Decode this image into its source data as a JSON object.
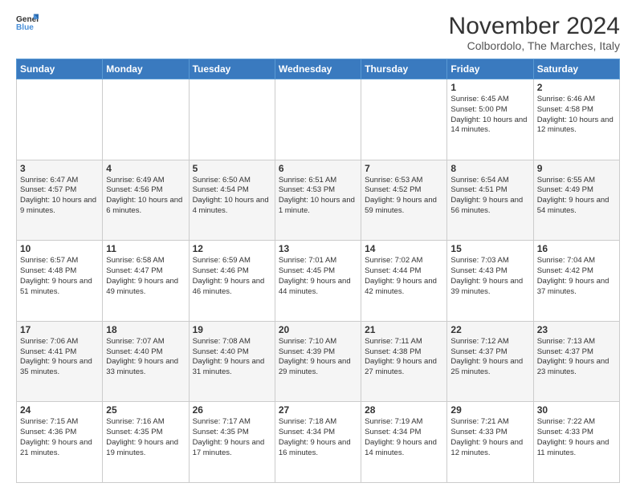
{
  "logo": {
    "line1": "General",
    "line2": "Blue"
  },
  "title": "November 2024",
  "subtitle": "Colbordolo, The Marches, Italy",
  "days_header": [
    "Sunday",
    "Monday",
    "Tuesday",
    "Wednesday",
    "Thursday",
    "Friday",
    "Saturday"
  ],
  "weeks": [
    [
      {
        "day": "",
        "info": ""
      },
      {
        "day": "",
        "info": ""
      },
      {
        "day": "",
        "info": ""
      },
      {
        "day": "",
        "info": ""
      },
      {
        "day": "",
        "info": ""
      },
      {
        "day": "1",
        "info": "Sunrise: 6:45 AM\nSunset: 5:00 PM\nDaylight: 10 hours and 14 minutes."
      },
      {
        "day": "2",
        "info": "Sunrise: 6:46 AM\nSunset: 4:58 PM\nDaylight: 10 hours and 12 minutes."
      }
    ],
    [
      {
        "day": "3",
        "info": "Sunrise: 6:47 AM\nSunset: 4:57 PM\nDaylight: 10 hours and 9 minutes."
      },
      {
        "day": "4",
        "info": "Sunrise: 6:49 AM\nSunset: 4:56 PM\nDaylight: 10 hours and 6 minutes."
      },
      {
        "day": "5",
        "info": "Sunrise: 6:50 AM\nSunset: 4:54 PM\nDaylight: 10 hours and 4 minutes."
      },
      {
        "day": "6",
        "info": "Sunrise: 6:51 AM\nSunset: 4:53 PM\nDaylight: 10 hours and 1 minute."
      },
      {
        "day": "7",
        "info": "Sunrise: 6:53 AM\nSunset: 4:52 PM\nDaylight: 9 hours and 59 minutes."
      },
      {
        "day": "8",
        "info": "Sunrise: 6:54 AM\nSunset: 4:51 PM\nDaylight: 9 hours and 56 minutes."
      },
      {
        "day": "9",
        "info": "Sunrise: 6:55 AM\nSunset: 4:49 PM\nDaylight: 9 hours and 54 minutes."
      }
    ],
    [
      {
        "day": "10",
        "info": "Sunrise: 6:57 AM\nSunset: 4:48 PM\nDaylight: 9 hours and 51 minutes."
      },
      {
        "day": "11",
        "info": "Sunrise: 6:58 AM\nSunset: 4:47 PM\nDaylight: 9 hours and 49 minutes."
      },
      {
        "day": "12",
        "info": "Sunrise: 6:59 AM\nSunset: 4:46 PM\nDaylight: 9 hours and 46 minutes."
      },
      {
        "day": "13",
        "info": "Sunrise: 7:01 AM\nSunset: 4:45 PM\nDaylight: 9 hours and 44 minutes."
      },
      {
        "day": "14",
        "info": "Sunrise: 7:02 AM\nSunset: 4:44 PM\nDaylight: 9 hours and 42 minutes."
      },
      {
        "day": "15",
        "info": "Sunrise: 7:03 AM\nSunset: 4:43 PM\nDaylight: 9 hours and 39 minutes."
      },
      {
        "day": "16",
        "info": "Sunrise: 7:04 AM\nSunset: 4:42 PM\nDaylight: 9 hours and 37 minutes."
      }
    ],
    [
      {
        "day": "17",
        "info": "Sunrise: 7:06 AM\nSunset: 4:41 PM\nDaylight: 9 hours and 35 minutes."
      },
      {
        "day": "18",
        "info": "Sunrise: 7:07 AM\nSunset: 4:40 PM\nDaylight: 9 hours and 33 minutes."
      },
      {
        "day": "19",
        "info": "Sunrise: 7:08 AM\nSunset: 4:40 PM\nDaylight: 9 hours and 31 minutes."
      },
      {
        "day": "20",
        "info": "Sunrise: 7:10 AM\nSunset: 4:39 PM\nDaylight: 9 hours and 29 minutes."
      },
      {
        "day": "21",
        "info": "Sunrise: 7:11 AM\nSunset: 4:38 PM\nDaylight: 9 hours and 27 minutes."
      },
      {
        "day": "22",
        "info": "Sunrise: 7:12 AM\nSunset: 4:37 PM\nDaylight: 9 hours and 25 minutes."
      },
      {
        "day": "23",
        "info": "Sunrise: 7:13 AM\nSunset: 4:37 PM\nDaylight: 9 hours and 23 minutes."
      }
    ],
    [
      {
        "day": "24",
        "info": "Sunrise: 7:15 AM\nSunset: 4:36 PM\nDaylight: 9 hours and 21 minutes."
      },
      {
        "day": "25",
        "info": "Sunrise: 7:16 AM\nSunset: 4:35 PM\nDaylight: 9 hours and 19 minutes."
      },
      {
        "day": "26",
        "info": "Sunrise: 7:17 AM\nSunset: 4:35 PM\nDaylight: 9 hours and 17 minutes."
      },
      {
        "day": "27",
        "info": "Sunrise: 7:18 AM\nSunset: 4:34 PM\nDaylight: 9 hours and 16 minutes."
      },
      {
        "day": "28",
        "info": "Sunrise: 7:19 AM\nSunset: 4:34 PM\nDaylight: 9 hours and 14 minutes."
      },
      {
        "day": "29",
        "info": "Sunrise: 7:21 AM\nSunset: 4:33 PM\nDaylight: 9 hours and 12 minutes."
      },
      {
        "day": "30",
        "info": "Sunrise: 7:22 AM\nSunset: 4:33 PM\nDaylight: 9 hours and 11 minutes."
      }
    ]
  ]
}
